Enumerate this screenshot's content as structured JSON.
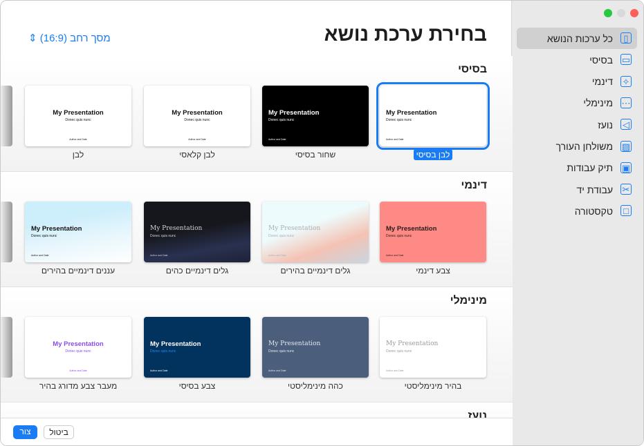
{
  "window": {
    "controls": {
      "close": "#fe5f57",
      "minimize": "#d9d9d9",
      "maximize": "#28c840"
    }
  },
  "sidebar": {
    "items": [
      {
        "label": "כל ערכות הנושא",
        "icon": "grid-icon",
        "selected": true
      },
      {
        "label": "בסיסי",
        "icon": "slide-icon"
      },
      {
        "label": "דינמי",
        "icon": "sparkles-icon"
      },
      {
        "label": "מינימלי",
        "icon": "ellipsis-rect-icon"
      },
      {
        "label": "נועז",
        "icon": "megaphone-icon"
      },
      {
        "label": "משולחן העורך",
        "icon": "photo-icon"
      },
      {
        "label": "תיק עבודות",
        "icon": "briefcase-icon"
      },
      {
        "label": "עבודת יד",
        "icon": "scissors-icon"
      },
      {
        "label": "טקסטורה",
        "icon": "texture-frame-icon"
      }
    ]
  },
  "header": {
    "title": "בחירת ערכת נושא",
    "aspect_label": "מסך רחב (16:9)",
    "aspect_icon": "updown-chevron-icon"
  },
  "thumb_text": {
    "title": "My Presentation",
    "subtitle": "Donec quis nunc",
    "author": "Author and Date"
  },
  "sections": [
    {
      "title": "בסיסי",
      "themes": [
        {
          "label": "לבן בסיסי",
          "bg": "#ffffff",
          "fg": "#111111",
          "selected": true
        },
        {
          "label": "שחור בסיסי",
          "bg": "#000000",
          "fg": "#ffffff"
        },
        {
          "label": "לבן קלאסי",
          "bg": "#ffffff",
          "fg": "#111111",
          "style": "center"
        },
        {
          "label": "לבן",
          "bg": "#ffffff",
          "fg": "#111111",
          "style": "center"
        }
      ]
    },
    {
      "title": "דינמי",
      "themes": [
        {
          "label": "צבע דינמי",
          "bg": "#fe8a85",
          "fg": "#2a1a1a"
        },
        {
          "label": "גלים דינמיים בהירים",
          "bg": "linear-gradient(160deg,#eefbfc 40%,#f4c2b4 70%,#c9d6de)",
          "fg": "#a9b0b5",
          "style": "light"
        },
        {
          "label": "גלים דינמיים כהים",
          "bg": "linear-gradient(170deg,#16171d 45%,#2a3150 75%,#1d2236)",
          "fg": "#d0d3da",
          "style": "light"
        },
        {
          "label": "עננים דינמיים בהירים",
          "bg": "linear-gradient(170deg,#cdeefb 30%,#e6f6fc 60%,#ffffff)",
          "fg": "#111111"
        }
      ]
    },
    {
      "title": "מינימלי",
      "themes": [
        {
          "label": "בהיר מינימליסטי",
          "bg": "#ffffff",
          "fg": "#9a9a9a",
          "style": "light"
        },
        {
          "label": "כהה מינימליסטי",
          "bg": "#4b5f7c",
          "fg": "#e3e7ee",
          "style": "light"
        },
        {
          "label": "צבע בסיסי",
          "bg": "#02335f",
          "fg": "#ffffff",
          "sub": "#1a8cff"
        },
        {
          "label": "מעבר צבע מדורג בהיר",
          "bg": "#ffffff",
          "fg": "#8a4bf0",
          "style": "center"
        }
      ]
    },
    {
      "title": "נועז",
      "themes": []
    }
  ],
  "footer": {
    "cancel": "ביטול",
    "create": "צור"
  }
}
